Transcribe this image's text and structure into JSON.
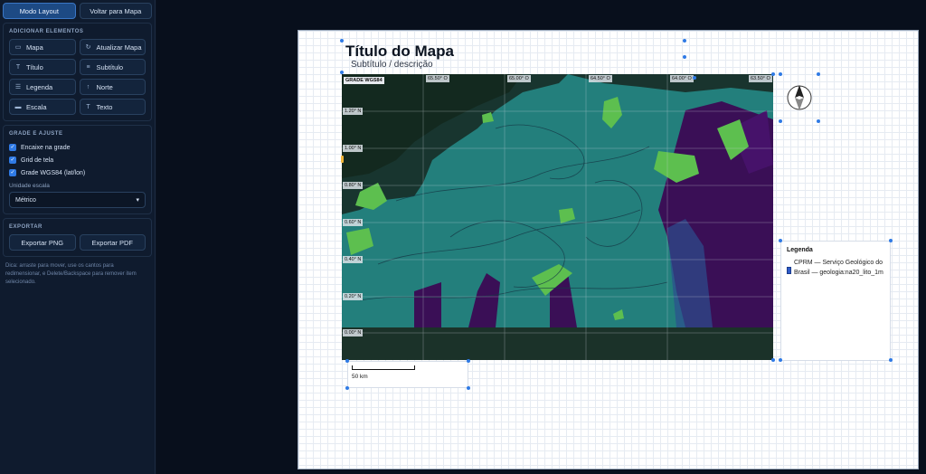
{
  "sidebar": {
    "mode_layout": "Modo Layout",
    "back_to_map": "Voltar para Mapa",
    "add_section_title": "ADICIONAR ELEMENTOS",
    "add_buttons": [
      {
        "label": "Mapa",
        "icon": "monitor-icon",
        "glyph": "▭"
      },
      {
        "label": "Atualizar Mapa",
        "icon": "refresh-icon",
        "glyph": "↻"
      },
      {
        "label": "Título",
        "icon": "title-icon",
        "glyph": "T"
      },
      {
        "label": "Subtítulo",
        "icon": "subtitle-icon",
        "glyph": "≡"
      },
      {
        "label": "Legenda",
        "icon": "legend-icon",
        "glyph": "☰"
      },
      {
        "label": "Norte",
        "icon": "north-arrow-icon",
        "glyph": "↑"
      },
      {
        "label": "Escala",
        "icon": "scale-icon",
        "glyph": "▬"
      },
      {
        "label": "Texto",
        "icon": "text-icon",
        "glyph": "T"
      }
    ],
    "grid_section_title": "GRADE E AJUSTE",
    "checks": [
      {
        "label": "Encaixe na grade",
        "checked": true
      },
      {
        "label": "Grid de tela",
        "checked": true
      },
      {
        "label": "Grade WGS84 (lat/lon)",
        "checked": true
      }
    ],
    "unit_label": "Unidade escala",
    "unit_value": "Métrico",
    "export_section_title": "EXPORTAR",
    "export_png": "Exportar PNG",
    "export_pdf": "Exportar PDF",
    "hint": "Dica: arraste para mover, use os cantos para redimensionar, e Delete/Backspace para remover item selecionado."
  },
  "layout": {
    "title": "Título do Mapa",
    "subtitle": "Subtítulo / descrição",
    "grid_label": "GRADE WGS84",
    "lon_labels": [
      "65.50° O",
      "65.00° O",
      "64.50° O",
      "64.00° O",
      "63.50° O"
    ],
    "lat_labels": [
      "1.20° N",
      "1.00° N",
      "0.80° N",
      "0.60° N",
      "0.40° N",
      "0.20° N",
      "0.00° N"
    ],
    "legend_title": "Legenda",
    "legend_text": "CPRM — Serviço Geológico do Brasil — geologia:na20_lito_1m",
    "legend_color": "#2e5bc9",
    "scale_text": "50 km"
  },
  "colors": {
    "accent": "#2f7ae5",
    "teal": "#1e7a78",
    "purple": "#3a0f56",
    "green": "#5dbf4f"
  }
}
